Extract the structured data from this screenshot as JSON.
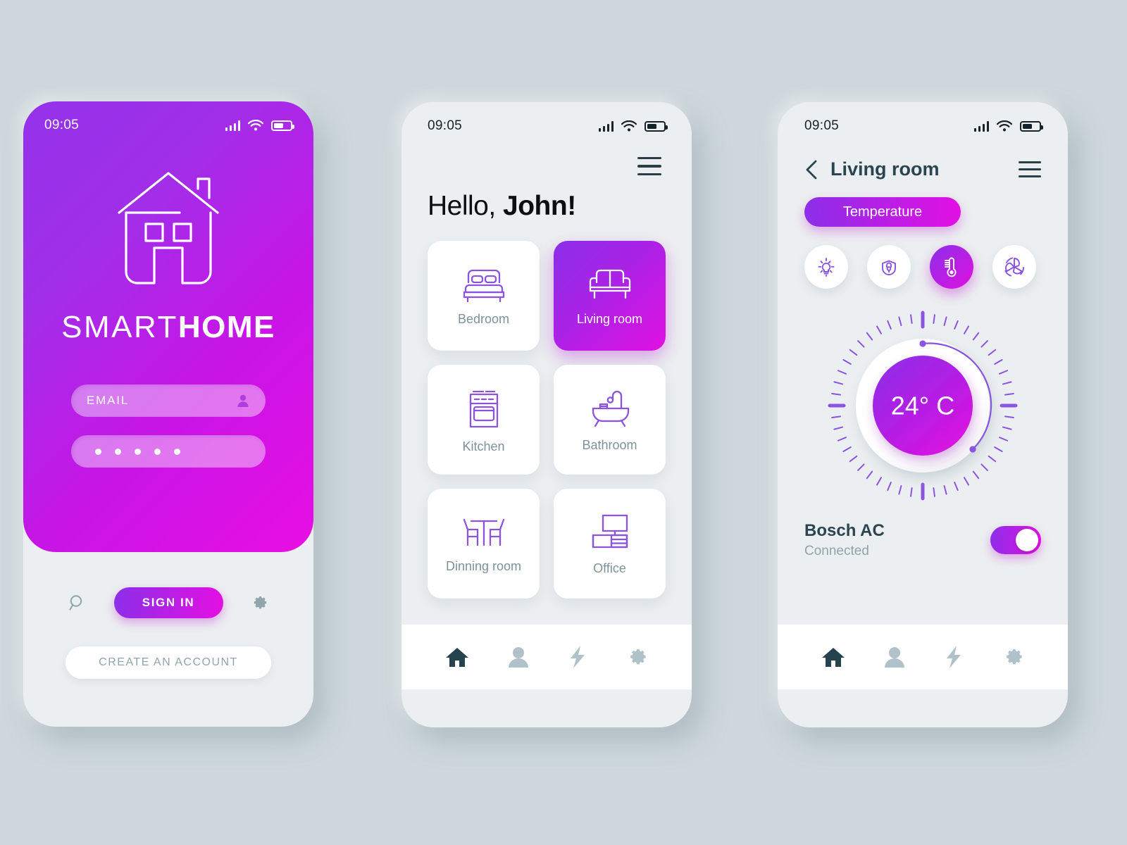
{
  "background_color": "#ced8dc",
  "accent": {
    "purple": "#8b2fe8",
    "magenta": "#e011e0",
    "muted_text": "#8fa3ab",
    "dark_text": "#2b4450"
  },
  "screens": [
    {
      "name": "login",
      "statusbar": {
        "time": "09:05",
        "signal_icon": "signal-bars-icon",
        "wifi_icon": "wifi-icon",
        "battery_icon": "battery-icon"
      },
      "logo_icon": "house-outline-icon",
      "brand_light": "SMART",
      "brand_bold": "HOME",
      "email_placeholder": "EMAIL",
      "email_icon": "user-icon",
      "password_dots": 5,
      "search_icon": "search-icon",
      "signin_label": "SIGN IN",
      "settings_icon": "gear-icon",
      "create_account_label": "CREATE AN ACCOUNT"
    },
    {
      "name": "rooms",
      "statusbar": {
        "time": "09:05"
      },
      "menu_icon": "hamburger-menu-icon",
      "greeting_light": "Hello, ",
      "greeting_bold": "John!",
      "rooms": [
        {
          "label": "Bedroom",
          "icon": "bed-icon",
          "active": false
        },
        {
          "label": "Living room",
          "icon": "sofa-icon",
          "active": true
        },
        {
          "label": "Kitchen",
          "icon": "oven-icon",
          "active": false
        },
        {
          "label": "Bathroom",
          "icon": "bathtub-icon",
          "active": false
        },
        {
          "label": "Dinning room",
          "icon": "dining-table-icon",
          "active": false
        },
        {
          "label": "Office",
          "icon": "desk-icon",
          "active": false
        }
      ],
      "tabs": [
        {
          "icon": "home-icon",
          "active": true
        },
        {
          "icon": "user-icon",
          "active": false
        },
        {
          "icon": "lightning-icon",
          "active": false
        },
        {
          "icon": "gear-icon",
          "active": false
        }
      ]
    },
    {
      "name": "room_detail",
      "statusbar": {
        "time": "09:05"
      },
      "back_icon": "chevron-left-icon",
      "title": "Living room",
      "menu_icon": "hamburger-menu-icon",
      "mode_pill": "Temperature",
      "controls": [
        {
          "icon": "lightbulb-icon",
          "active": false
        },
        {
          "icon": "lock-icon",
          "active": false
        },
        {
          "icon": "thermometer-icon",
          "active": true
        },
        {
          "icon": "fan-icon",
          "active": false
        }
      ],
      "dial": {
        "value": "24° C",
        "ticks": 48,
        "arc_start_deg": -90,
        "arc_end_deg": 55
      },
      "device": {
        "name": "Bosch AC",
        "state": "Connected",
        "toggle_on": true
      },
      "tabs": [
        {
          "icon": "home-icon",
          "active": true
        },
        {
          "icon": "user-icon",
          "active": false
        },
        {
          "icon": "lightning-icon",
          "active": false
        },
        {
          "icon": "gear-icon",
          "active": false
        }
      ]
    }
  ]
}
